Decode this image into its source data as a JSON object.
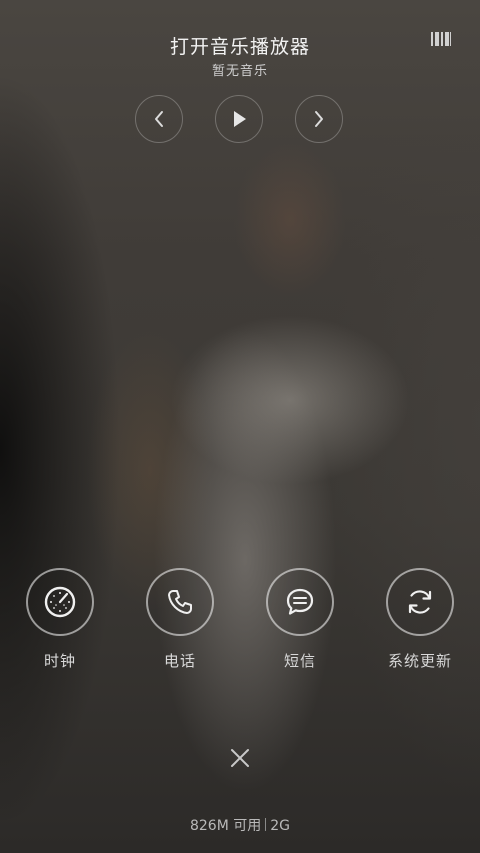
{
  "music": {
    "title": "打开音乐播放器",
    "subtitle": "暂无音乐",
    "controls": {
      "prev_icon": "chevron-left-icon",
      "play_icon": "play-icon",
      "next_icon": "chevron-right-icon"
    },
    "menu_icon": "barcode-icon"
  },
  "shortcuts": [
    {
      "label": "时钟",
      "icon": "clock-icon"
    },
    {
      "label": "电话",
      "icon": "phone-icon"
    },
    {
      "label": "短信",
      "icon": "message-icon"
    },
    {
      "label": "系统更新",
      "icon": "refresh-icon"
    }
  ],
  "close_icon": "close-icon",
  "status": {
    "memory": "826M 可用",
    "network": "2G"
  }
}
